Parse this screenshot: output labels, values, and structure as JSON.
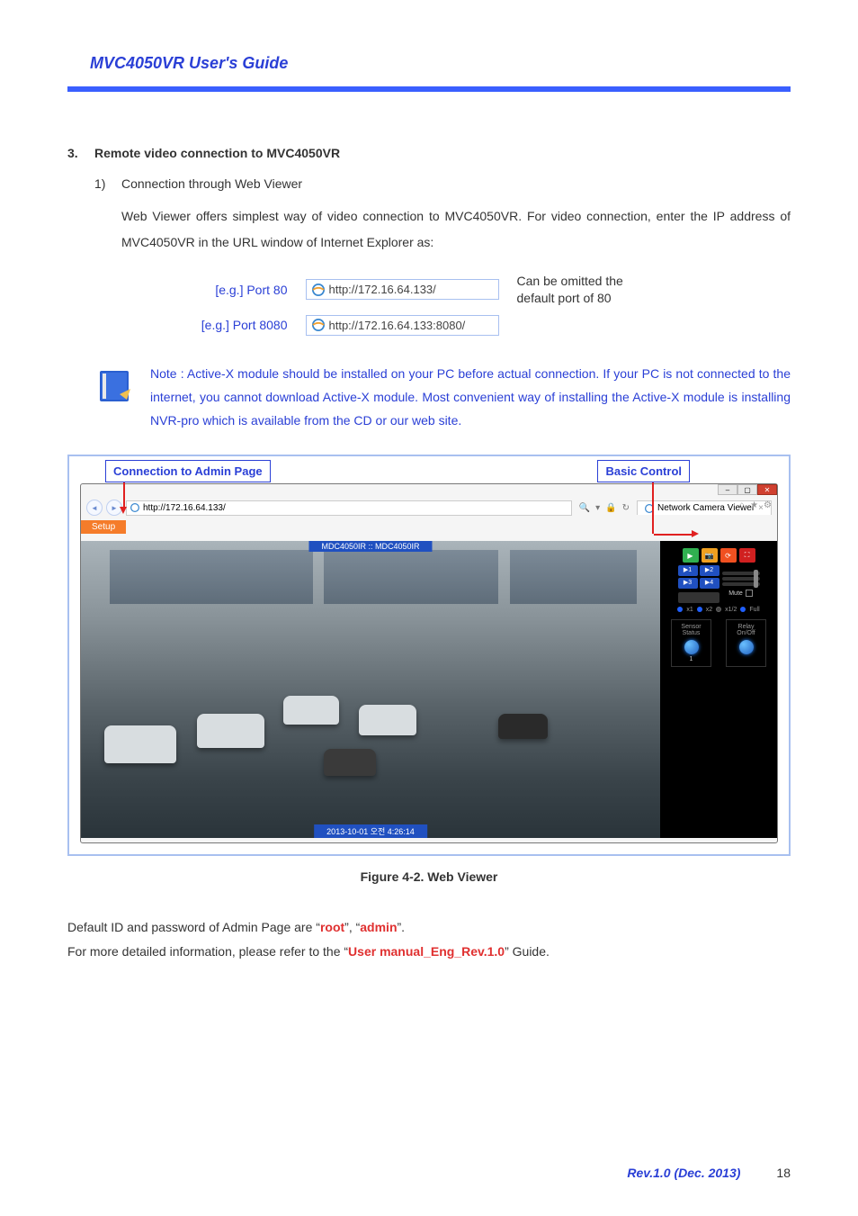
{
  "header": {
    "title": "MVC4050VR User's Guide"
  },
  "section": {
    "num": "3.",
    "title": "Remote video connection to MVC4050VR",
    "sub_num": "1)",
    "sub_title": "Connection through Web Viewer",
    "para": "Web Viewer offers simplest way of video connection to MVC4050VR. For video connection, enter the IP address of MVC4050VR in the URL window of Internet Explorer as:"
  },
  "port_examples": {
    "row1": {
      "label": "[e.g.] Port 80",
      "url": "http://172.16.64.133/",
      "note1": "Can be omitted the",
      "note2": "default port of 80"
    },
    "row2": {
      "label": "[e.g.] Port 8080",
      "url": "http://172.16.64.133:8080/"
    }
  },
  "note": {
    "text": "Note : Active-X module should be installed on your PC before actual connection. If your PC is not connected to the internet, you cannot download Active-X module. Most convenient way of installing the Active-X module is installing NVR-pro which is available from the CD or our web site."
  },
  "callouts": {
    "admin": "Connection to Admin Page",
    "basic": "Basic Control"
  },
  "ie": {
    "address": "http://172.16.64.133/",
    "tab_title": "Network Camera Viewer",
    "search_icon": "🔍",
    "refresh_icon": "↻",
    "setup_btn": "Setup",
    "video_title": "MDC4050IR :: MDC4050IR",
    "video_time": "2013-10-01 오전 4:26:14",
    "controls": {
      "zoom1": "▶1",
      "zoom2": "▶2",
      "zoom3": "▶3",
      "zoom4": "▶4",
      "mute": "Mute",
      "scale": {
        "x1": "x1",
        "x2": "x2",
        "x12": "x1/2",
        "full": "Full"
      },
      "sensor": "Sensor Status",
      "relay": "Relay On/Off",
      "sensor_num": "1"
    }
  },
  "caption": "Figure 4-2. Web Viewer",
  "credentials": {
    "line1_a": "Default ID and password of Admin Page are “",
    "root": "root",
    "line1_b": "”, “",
    "admin": "admin",
    "line1_c": "”.",
    "line2_a": "For more detailed information, please refer to the “",
    "manual": "User manual_Eng_Rev.1.0",
    "line2_b": "” Guide."
  },
  "footer": {
    "rev": "Rev.1.0 (Dec. 2013)",
    "page": "18"
  }
}
